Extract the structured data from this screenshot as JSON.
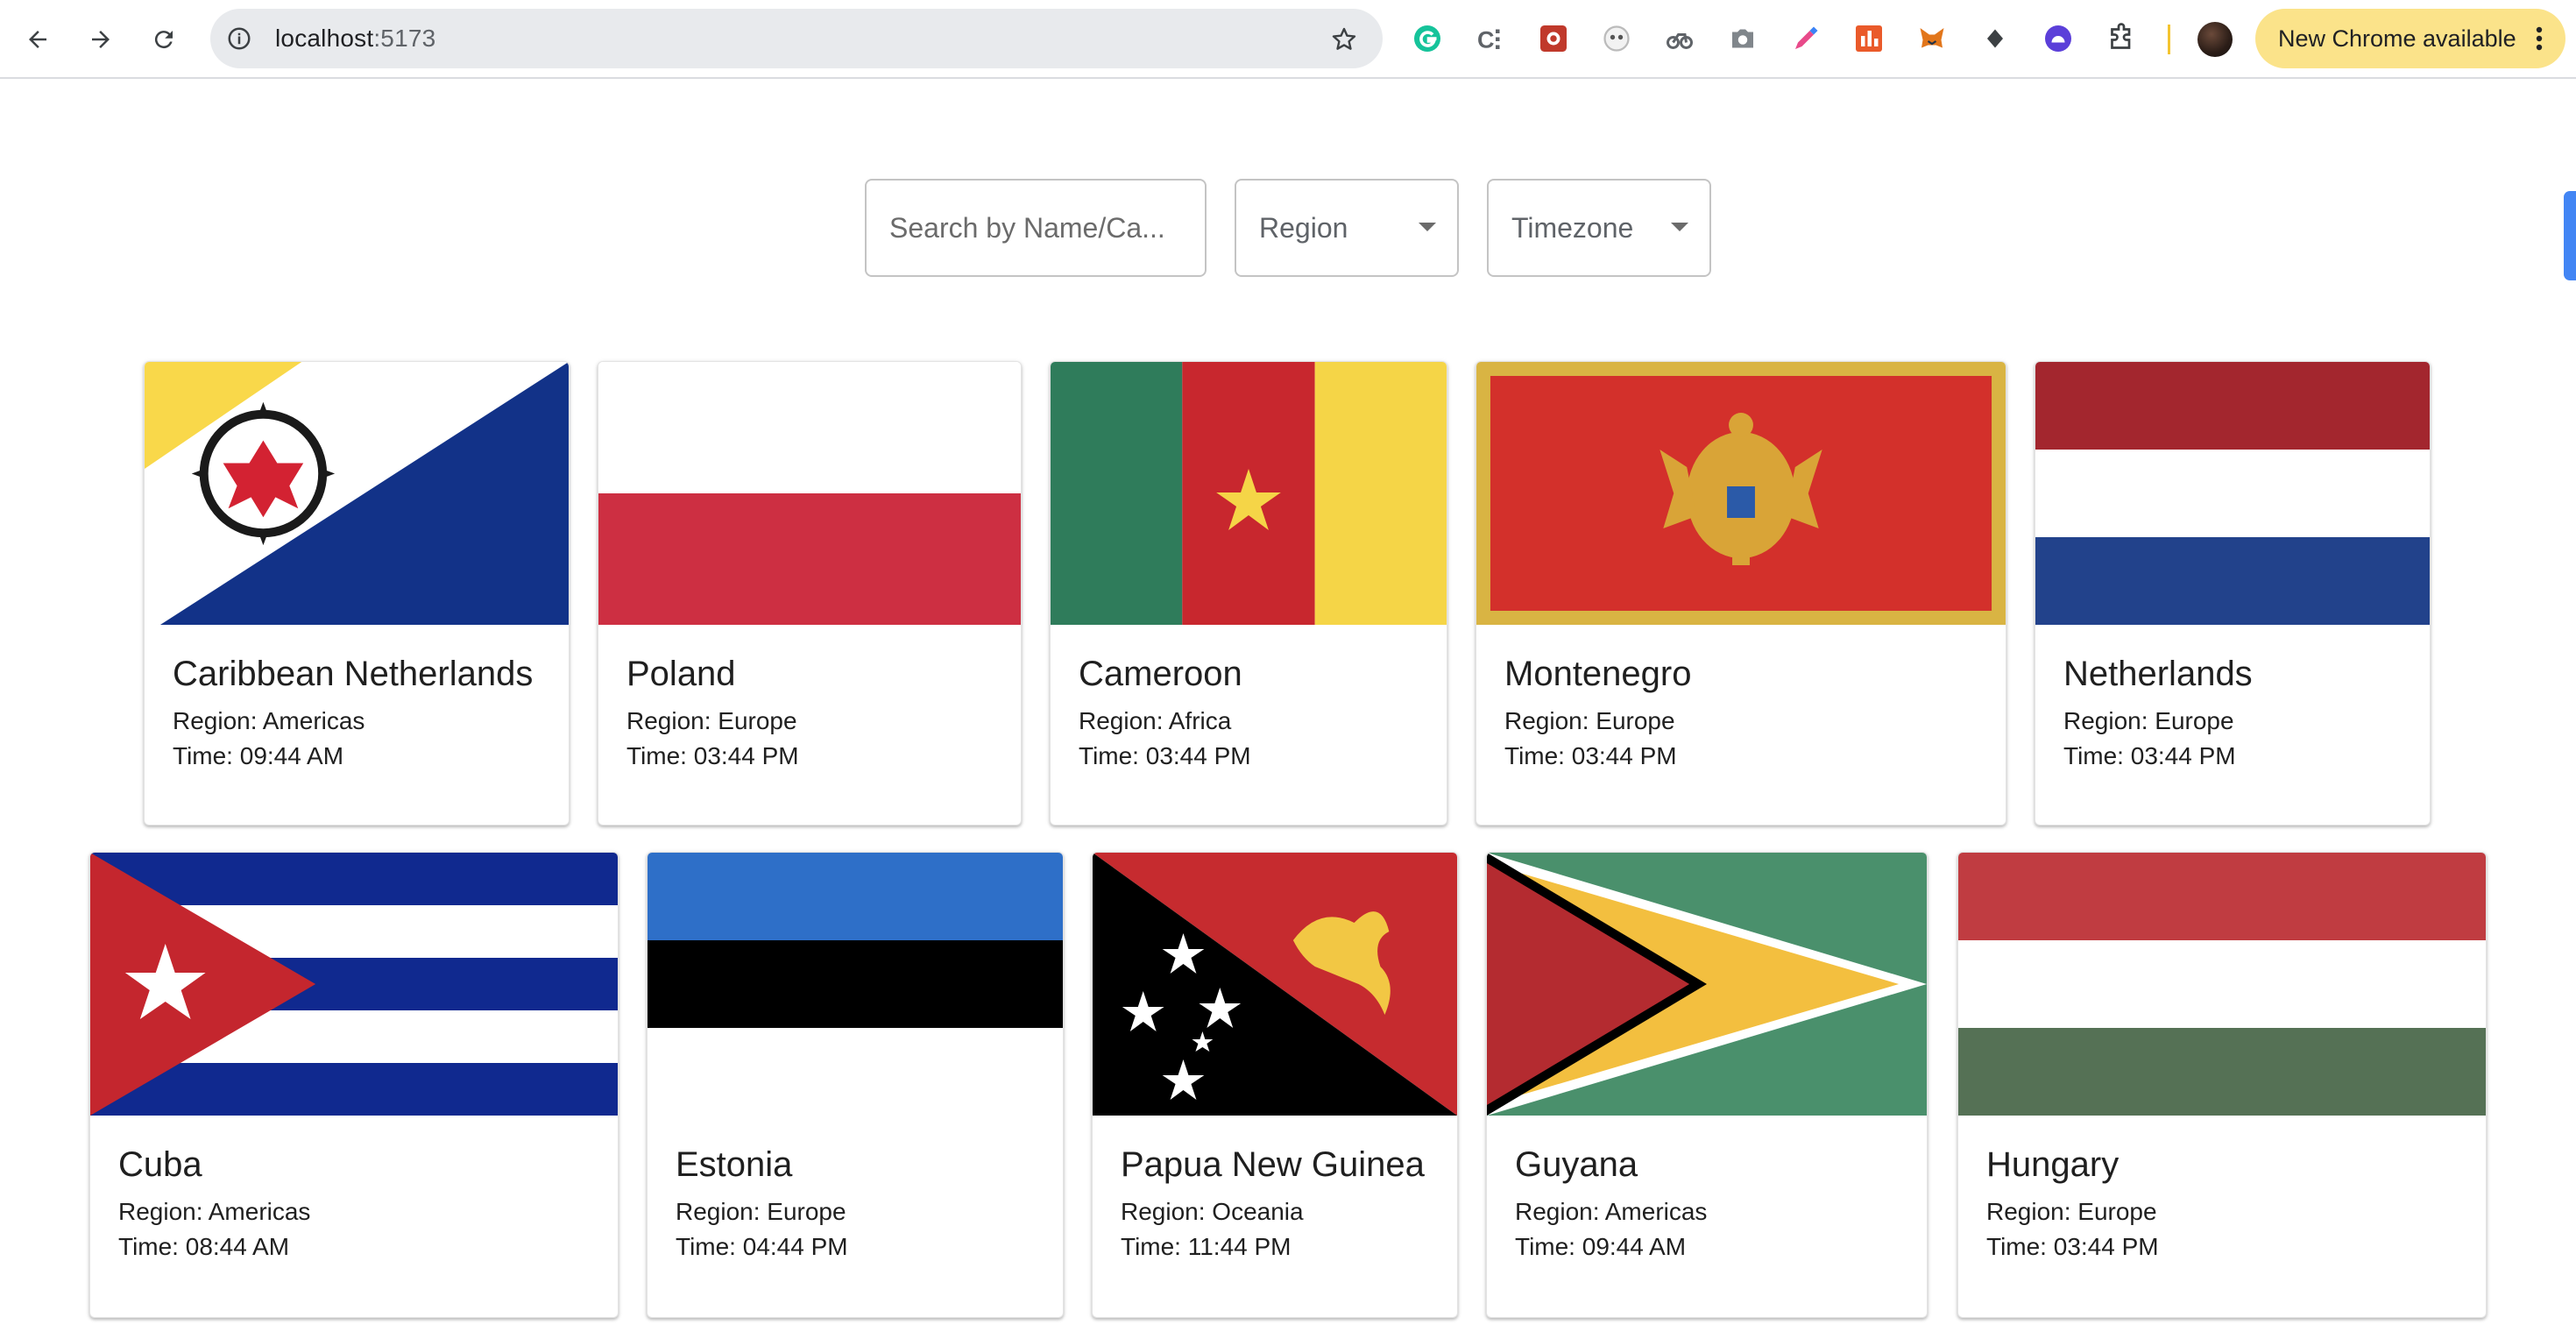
{
  "browser": {
    "url_host": "localhost",
    "url_port": ":5173",
    "update_button": "New Chrome available"
  },
  "controls": {
    "search_placeholder": "Search by Name/Ca...",
    "region_label": "Region",
    "timezone_label": "Timezone"
  },
  "countries": [
    {
      "name": "Caribbean Netherlands",
      "region": "Region: Americas",
      "time": "Time: 09:44 AM",
      "flag": "bq"
    },
    {
      "name": "Poland",
      "region": "Region: Europe",
      "time": "Time: 03:44 PM",
      "flag": "pl"
    },
    {
      "name": "Cameroon",
      "region": "Region: Africa",
      "time": "Time: 03:44 PM",
      "flag": "cm"
    },
    {
      "name": "Montenegro",
      "region": "Region: Europe",
      "time": "Time: 03:44 PM",
      "flag": "me"
    },
    {
      "name": "Netherlands",
      "region": "Region: Europe",
      "time": "Time: 03:44 PM",
      "flag": "nl"
    },
    {
      "name": "Cuba",
      "region": "Region: Americas",
      "time": "Time: 08:44 AM",
      "flag": "cu"
    },
    {
      "name": "Estonia",
      "region": "Region: Europe",
      "time": "Time: 04:44 PM",
      "flag": "ee"
    },
    {
      "name": "Papua New Guinea",
      "region": "Region: Oceania",
      "time": "Time: 11:44 PM",
      "flag": "pg"
    },
    {
      "name": "Guyana",
      "region": "Region: Americas",
      "time": "Time: 09:44 AM",
      "flag": "gy"
    },
    {
      "name": "Hungary",
      "region": "Region: Europe",
      "time": "Time: 03:44 PM",
      "flag": "hu"
    }
  ],
  "colors": {
    "accent_blue": "#4285f4",
    "update_pill": "#fbe38a"
  }
}
